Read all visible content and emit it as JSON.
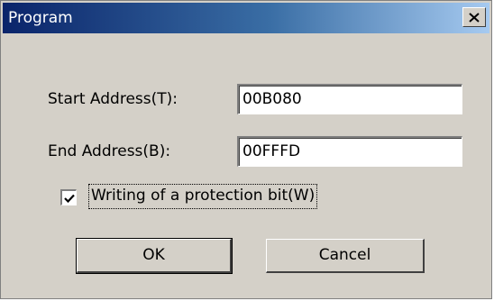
{
  "window": {
    "title": "Program",
    "close_icon": "close-icon"
  },
  "form": {
    "start_label": "Start Address(T):",
    "start_value": "00B080",
    "end_label": "End Address(B):",
    "end_value": "00FFFD",
    "checkbox_label": "Writing of a protection bit(W)",
    "checkbox_checked": true
  },
  "buttons": {
    "ok": "OK",
    "cancel": "Cancel"
  }
}
